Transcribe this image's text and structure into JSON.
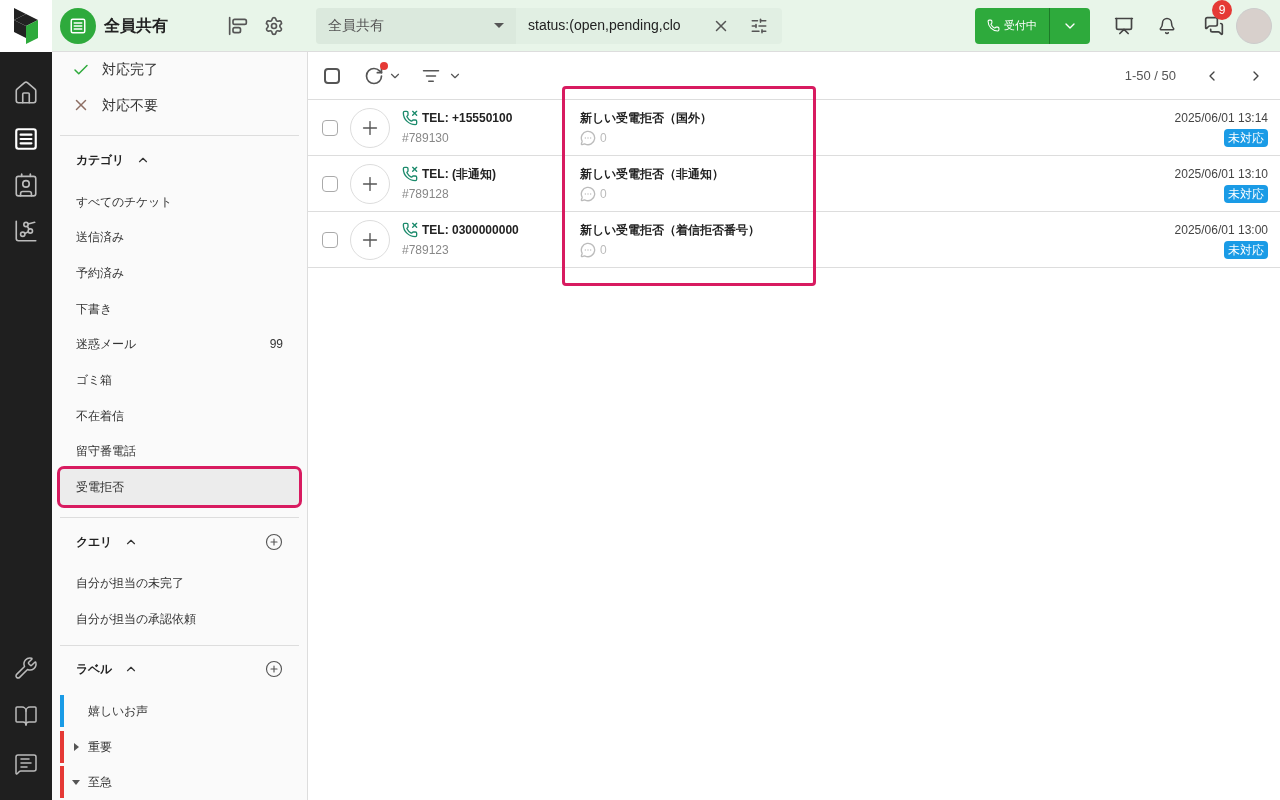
{
  "workspace": {
    "title": "全員共有"
  },
  "search": {
    "scope": "全員共有",
    "query": "status:(open,pending,clo"
  },
  "reception": {
    "label": "受付中"
  },
  "chat_badge": "9",
  "sidebar": {
    "status_items": [
      {
        "kind": "done",
        "label": "対応完了"
      },
      {
        "kind": "unneeded",
        "label": "対応不要"
      }
    ],
    "category": {
      "title": "カテゴリ",
      "expanded": true,
      "items": [
        {
          "label": "すべてのチケット",
          "selected": false,
          "highlighted": false
        },
        {
          "label": "送信済み",
          "selected": false,
          "highlighted": false
        },
        {
          "label": "予約済み",
          "selected": false,
          "highlighted": false
        },
        {
          "label": "下書き",
          "selected": false,
          "highlighted": false
        },
        {
          "label": "迷惑メール",
          "count": "99",
          "selected": false,
          "highlighted": false
        },
        {
          "label": "ゴミ箱",
          "selected": false,
          "highlighted": false
        },
        {
          "label": "不在着信",
          "selected": false,
          "highlighted": false
        },
        {
          "label": "留守番電話",
          "selected": false,
          "highlighted": false
        },
        {
          "label": "受電拒否",
          "selected": true,
          "highlighted": true
        }
      ]
    },
    "query": {
      "title": "クエリ",
      "expanded": true,
      "items": [
        {
          "label": "自分が担当の未完了"
        },
        {
          "label": "自分が担当の承認依頼"
        }
      ]
    },
    "labels": {
      "title": "ラベル",
      "expanded": true,
      "items": [
        {
          "kind": "leaf",
          "label": "嬉しいお声",
          "color": "#1a9be6"
        },
        {
          "kind": "collapsed",
          "label": "重要",
          "color": "#e53935"
        },
        {
          "kind": "expanded",
          "label": "至急",
          "color": "#e53935"
        }
      ]
    }
  },
  "toolbar": {
    "select_all_checked": false,
    "refresh_alert": true,
    "range": "1-50 / 50"
  },
  "subject_column_highlighted": true,
  "tickets": [
    {
      "checked": false,
      "title": "TEL: +15550100",
      "number": "#789130",
      "subject": "新しい受電拒否（国外）",
      "comments": "0",
      "date": "2025/06/01 13:14",
      "status": "未対応",
      "color": "#1a9be6"
    },
    {
      "checked": false,
      "title": "TEL: (非通知)",
      "number": "#789128",
      "subject": "新しい受電拒否（非通知）",
      "comments": "0",
      "date": "2025/06/01 13:10",
      "status": "未対応",
      "color": "#1a9be6"
    },
    {
      "checked": false,
      "title": "TEL: 0300000000",
      "number": "#789123",
      "subject": "新しい受電拒否（着信拒否番号）",
      "comments": "0",
      "date": "2025/06/01 13:00",
      "status": "未対応",
      "color": "#1a9be6"
    }
  ]
}
